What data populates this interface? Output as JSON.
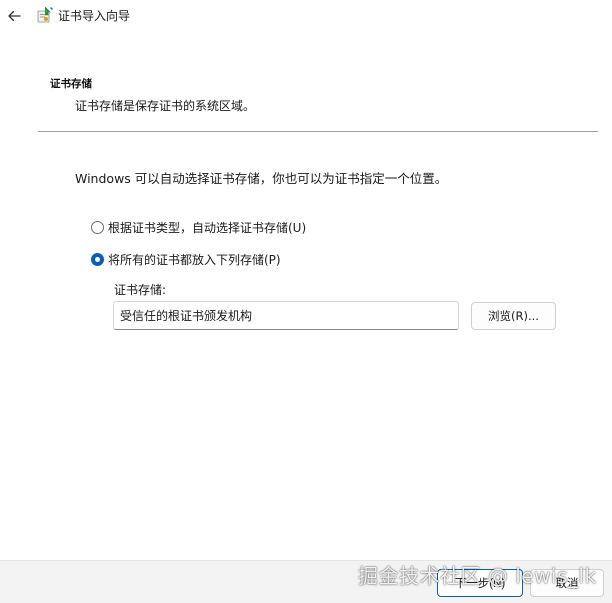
{
  "window": {
    "title": "证书导入向导",
    "back_icon": "arrow-left-icon",
    "wizard_icon": "certificate-wizard-icon"
  },
  "header": {
    "heading": "证书存储",
    "description": "证书存储是保存证书的系统区域。"
  },
  "main": {
    "intro": "Windows 可以自动选择证书存储，你也可以为证书指定一个位置。",
    "options": [
      {
        "label": "根据证书类型，自动选择证书存储(U)",
        "selected": false
      },
      {
        "label": "将所有的证书都放入下列存储(P)",
        "selected": true
      }
    ],
    "store_label": "证书存储:",
    "store_value": "受信任的根证书颁发机构",
    "browse_label": "浏览(R)..."
  },
  "footer": {
    "next_label": "下一步(N)",
    "cancel_label": "取消"
  },
  "watermark": "掘金技术社区 @ lewis_lk",
  "colors": {
    "accent": "#0a5fb4",
    "footer_bg": "#f3f3f3",
    "divider": "#a0a0a0"
  }
}
